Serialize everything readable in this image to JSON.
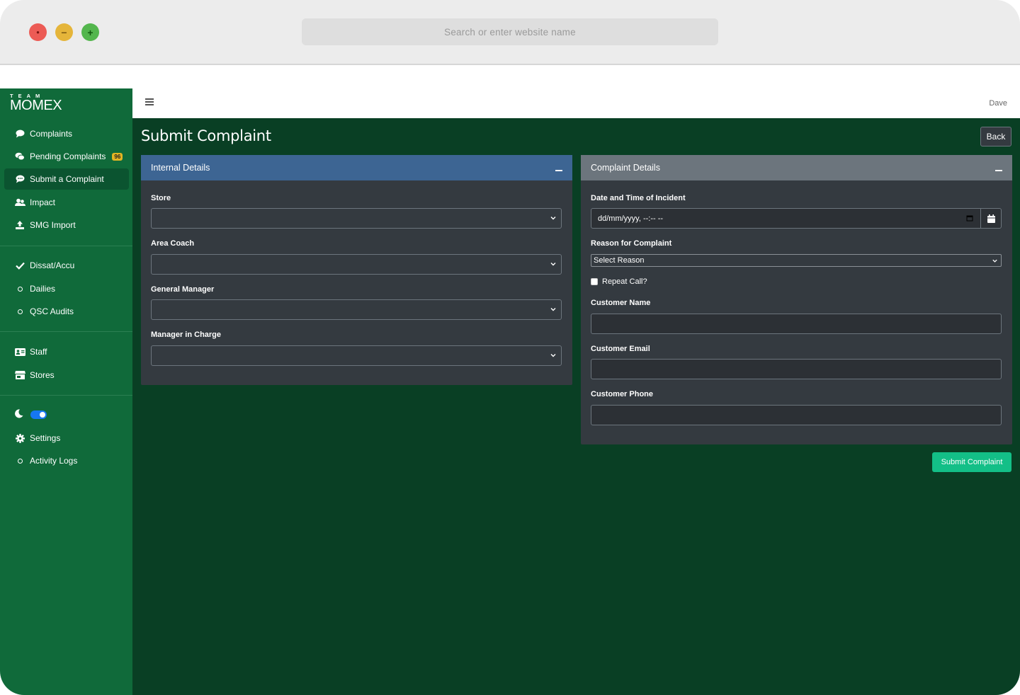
{
  "browser": {
    "url_placeholder": "Search or enter website name"
  },
  "brand": {
    "top": "TEAM",
    "main": "MOMEX"
  },
  "sidebar": {
    "items": [
      {
        "label": "Complaints",
        "icon": "comment-icon"
      },
      {
        "label": "Pending Complaints",
        "icon": "comments-icon",
        "badge": "96"
      },
      {
        "label": "Submit a Complaint",
        "icon": "comment-dots-icon",
        "active": true
      },
      {
        "label": "Impact",
        "icon": "users-icon"
      },
      {
        "label": "SMG Import",
        "icon": "upload-icon"
      },
      {
        "label": "Dissat/Accu",
        "icon": "check-icon"
      },
      {
        "label": "Dailies",
        "icon": "circle-icon"
      },
      {
        "label": "QSC Audits",
        "icon": "circle-icon"
      },
      {
        "label": "Staff",
        "icon": "id-card-icon"
      },
      {
        "label": "Stores",
        "icon": "store-icon"
      },
      {
        "label": "Settings",
        "icon": "gear-icon"
      },
      {
        "label": "Activity Logs",
        "icon": "circle-icon"
      }
    ],
    "dark_mode_toggle": true
  },
  "topbar": {
    "user": "Dave"
  },
  "page": {
    "title": "Submit Complaint",
    "back_label": "Back",
    "submit_label": "Submit Complaint"
  },
  "internal_details": {
    "title": "Internal Details",
    "fields": {
      "store": "Store",
      "area_coach": "Area Coach",
      "general_manager": "General Manager",
      "manager_in_charge": "Manager in Charge"
    }
  },
  "complaint_details": {
    "title": "Complaint Details",
    "date_label": "Date and Time of Incident",
    "date_value": "dd/mm/yyyy, --:-- --",
    "reason_label": "Reason for Complaint",
    "reason_value": "Select Reason",
    "repeat_call_label": "Repeat Call?",
    "customer_name_label": "Customer Name",
    "customer_email_label": "Customer Email",
    "customer_phone_label": "Customer Phone"
  },
  "colors": {
    "sidebar": "#106a3a",
    "content": "#093f24",
    "card": "#343a40",
    "internal_header": "#3d6593",
    "complaint_header": "#6c757d",
    "submit": "#13bf87",
    "badge": "#e2b423"
  }
}
